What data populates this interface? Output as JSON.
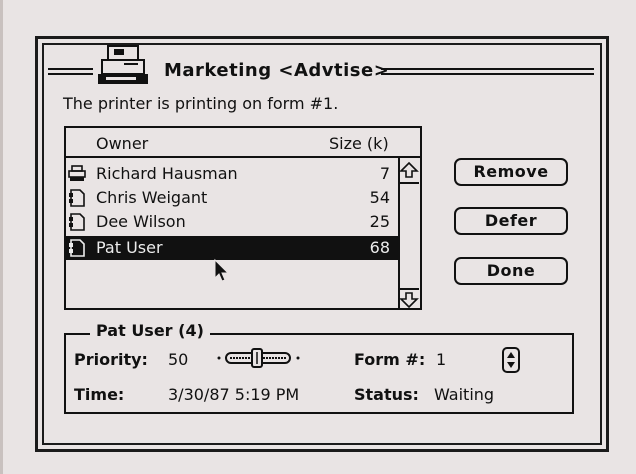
{
  "window": {
    "title": "Marketing <Advtise>",
    "status_message": "The printer is printing on form #1."
  },
  "queue": {
    "columns": {
      "owner": "Owner",
      "size": "Size (k)"
    },
    "rows": [
      {
        "owner": "Richard Hausman",
        "size": "7",
        "icon": "printer-icon",
        "selected": false
      },
      {
        "owner": "Chris Weigant",
        "size": "54",
        "icon": "document-icon",
        "selected": false
      },
      {
        "owner": "Dee Wilson",
        "size": "25",
        "icon": "document-icon",
        "selected": false
      },
      {
        "owner": "Pat User",
        "size": "68",
        "icon": "document-icon",
        "selected": true
      }
    ]
  },
  "buttons": {
    "remove": "Remove",
    "defer": "Defer",
    "done": "Done"
  },
  "details": {
    "title": "Pat User (4)",
    "priority_label": "Priority:",
    "priority_value": "50",
    "form_label": "Form #:",
    "form_value": "1",
    "time_label": "Time:",
    "time_value": "3/30/87 5:19 PM",
    "status_label": "Status:",
    "status_value": "Waiting"
  }
}
